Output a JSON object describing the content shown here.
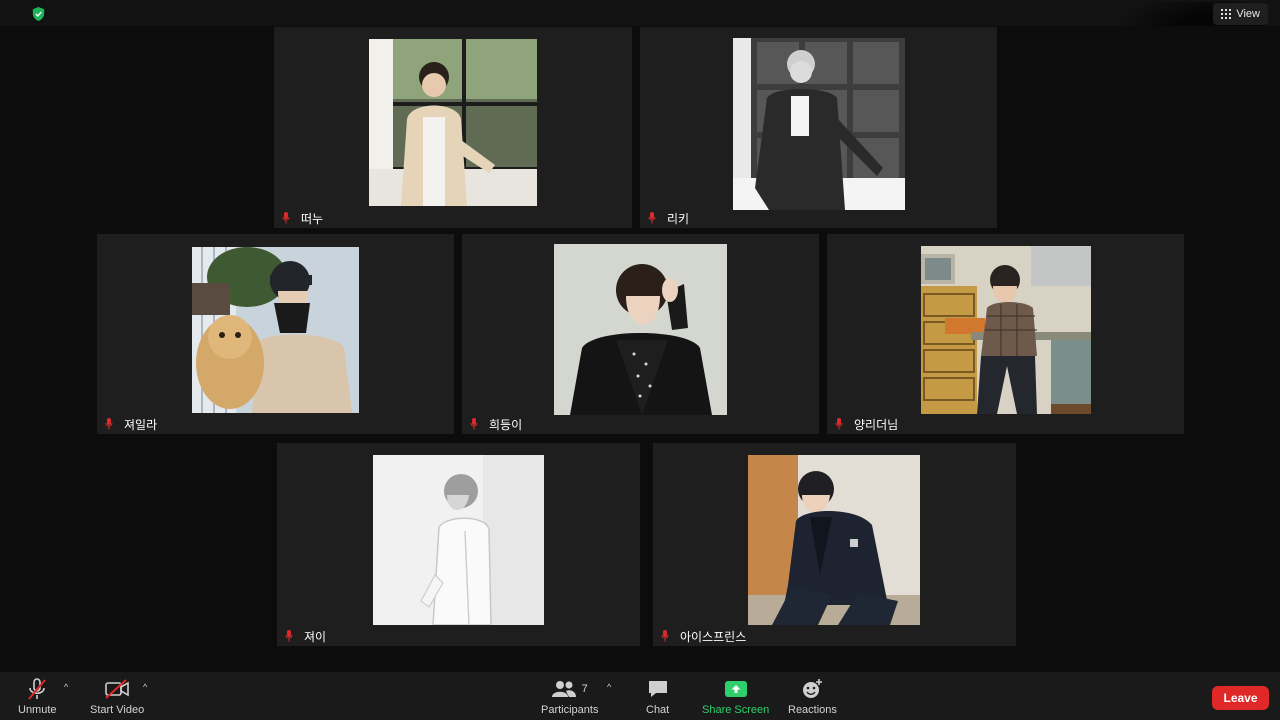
{
  "topbar": {
    "view_label": "View"
  },
  "participants": [
    {
      "name": "떠누",
      "mic": "muted"
    },
    {
      "name": "리키",
      "mic": "muted"
    },
    {
      "name": "져일라",
      "mic": "muted"
    },
    {
      "name": "희등이",
      "mic": "muted"
    },
    {
      "name": "양리더님",
      "mic": "muted"
    },
    {
      "name": "져이",
      "mic": "muted"
    },
    {
      "name": "아이스프린스",
      "mic": "muted"
    }
  ],
  "toolbar": {
    "unmute_label": "Unmute",
    "start_video_label": "Start Video",
    "participants_label": "Participants",
    "participants_count": "7",
    "chat_label": "Chat",
    "share_screen_label": "Share Screen",
    "reactions_label": "Reactions",
    "leave_label": "Leave"
  },
  "colors": {
    "share_green": "#2fd06c",
    "leave_red": "#e02828",
    "muted_mic_red": "#d92b2b",
    "security_shield_green": "#1fb45a"
  }
}
